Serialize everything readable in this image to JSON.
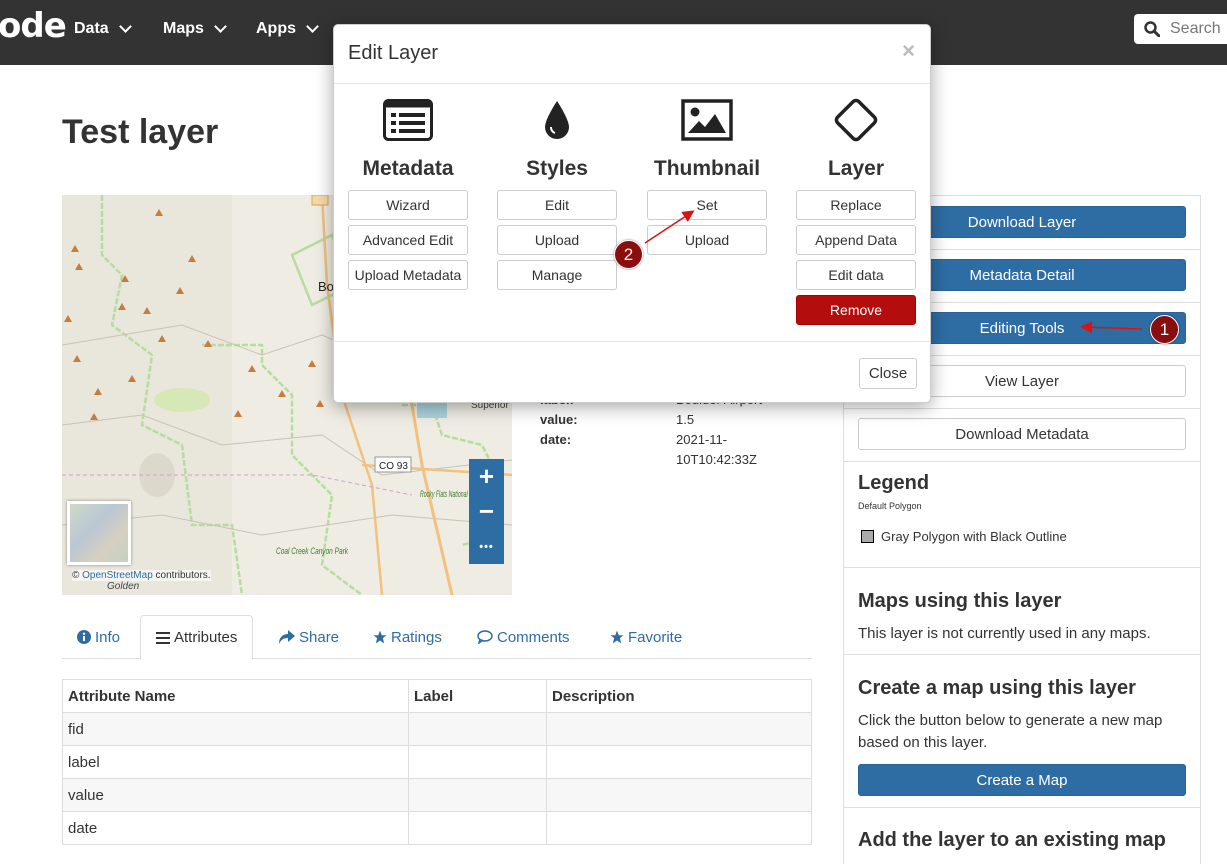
{
  "navbar": {
    "brand": "ode",
    "items": [
      {
        "label": "Data"
      },
      {
        "label": "Maps"
      },
      {
        "label": "Apps"
      }
    ],
    "search_placeholder": "Search"
  },
  "page": {
    "title": "Test layer"
  },
  "map": {
    "labels": [
      "Bo",
      "Superior",
      "CO 93",
      "Rocky Flats National Wildlife Refuge",
      "Coal Creek Canyon Park",
      "Golden"
    ],
    "zoom_in": "+",
    "zoom_out": "−",
    "more": "•••",
    "attribution_prefix": "©",
    "attribution_link": "OpenStreetMap",
    "attribution_suffix": "contributors."
  },
  "info": {
    "rows": [
      {
        "key": "label:",
        "value": "Boulder Airport"
      },
      {
        "key": "value:",
        "value": "1.5"
      },
      {
        "key": "date:",
        "value": "2021-11-"
      },
      {
        "key": "",
        "value": "10T10:42:33Z"
      }
    ]
  },
  "tabs": [
    {
      "label": "Info",
      "icon": "info-circle-icon"
    },
    {
      "label": "Attributes",
      "icon": "list-icon"
    },
    {
      "label": "Share",
      "icon": "share-icon"
    },
    {
      "label": "Ratings",
      "icon": "star-icon"
    },
    {
      "label": "Comments",
      "icon": "comment-icon"
    },
    {
      "label": "Favorite",
      "icon": "star-icon"
    }
  ],
  "attributes_table": {
    "headers": [
      "Attribute Name",
      "Label",
      "Description"
    ],
    "rows": [
      [
        "fid",
        "",
        ""
      ],
      [
        "label",
        "",
        ""
      ],
      [
        "value",
        "",
        ""
      ],
      [
        "date",
        "",
        ""
      ]
    ]
  },
  "sidebar": {
    "download_layer": "Download Layer",
    "metadata_detail": "Metadata Detail",
    "editing_tools": "Editing Tools",
    "view_layer": "View Layer",
    "download_metadata": "Download Metadata",
    "legend_title": "Legend",
    "legend_subtitle": "Default Polygon",
    "legend_item": "Gray Polygon with Black Outline",
    "maps_using_title": "Maps using this layer",
    "maps_using_text": "This layer is not currently used in any maps.",
    "create_map_title": "Create a map using this layer",
    "create_map_text": "Click the button below to generate a new map based on this layer.",
    "create_map_button": "Create a Map",
    "add_existing_title": "Add the layer to an existing map"
  },
  "modal": {
    "title": "Edit Layer",
    "close_x": "×",
    "columns": [
      {
        "heading": "Metadata",
        "icon": "list-alt-icon",
        "buttons": [
          "Wizard",
          "Advanced Edit",
          "Upload Metadata"
        ]
      },
      {
        "heading": "Styles",
        "icon": "tint-icon",
        "buttons": [
          "Edit",
          "Upload",
          "Manage"
        ]
      },
      {
        "heading": "Thumbnail",
        "icon": "picture-icon",
        "buttons": [
          "Set",
          "Upload"
        ]
      },
      {
        "heading": "Layer",
        "icon": "diamond-icon",
        "buttons": [
          "Replace",
          "Append Data",
          "Edit data",
          "Remove"
        ]
      }
    ],
    "close_button": "Close"
  },
  "annotations": {
    "callout_1": "1",
    "callout_2": "2",
    "color": "#8b0e0e"
  },
  "colors": {
    "navbar": "#333333",
    "primary": "#2e6da4",
    "danger": "#b30d0d"
  }
}
